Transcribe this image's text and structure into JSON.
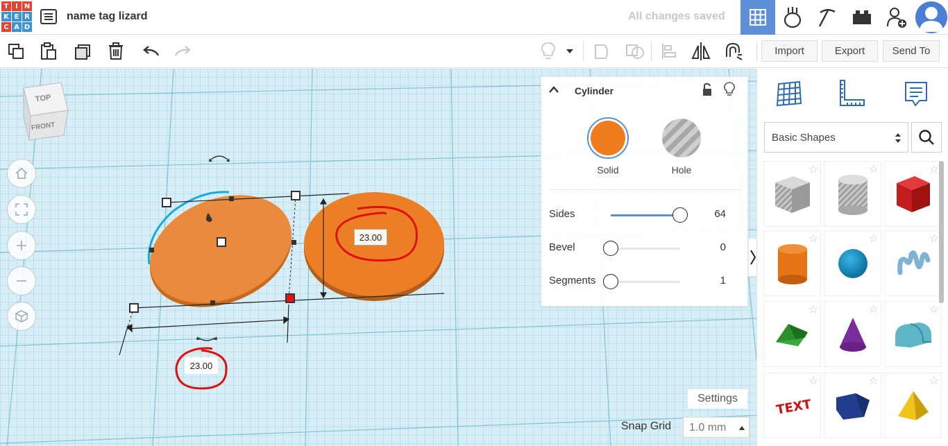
{
  "header": {
    "logo_letters": [
      "T",
      "I",
      "N",
      "K",
      "E",
      "R",
      "C",
      "A",
      "D"
    ],
    "logo_colors": [
      "#e2442f",
      "#e2442f",
      "#e2442f",
      "#3d93d1",
      "#3d93d1",
      "#3d93d1",
      "#e2442f",
      "#3d93d1",
      "#3d93d1"
    ],
    "design_title": "name tag lizard",
    "save_status": "All changes saved",
    "buttons": [
      "3d-view-icon",
      "circuits-icon",
      "blocks-icon",
      "bricks-icon",
      "add-user-icon"
    ],
    "active_color": "#5c8fd6"
  },
  "toolbar": {
    "icons": [
      "copy-icon",
      "paste-icon",
      "duplicate-icon",
      "delete-icon",
      "undo-icon",
      "redo-icon",
      "light-icon",
      "dropdown-icon",
      "group-icon",
      "ungroup-icon",
      "align-icon",
      "mirror-icon",
      "magnet-icon"
    ],
    "import_label": "Import",
    "export_label": "Export",
    "sendto_label": "Send To"
  },
  "viewcube": {
    "top_label": "TOP",
    "front_label": "FRONT"
  },
  "nav": [
    "home-icon",
    "fit-icon",
    "zoom-in-icon",
    "zoom-out-icon",
    "perspective-icon"
  ],
  "dimensions": {
    "width_value": "23.00",
    "depth_value": "23.00"
  },
  "inspector": {
    "shape_name": "Cylinder",
    "solid_label": "Solid",
    "hole_label": "Hole",
    "solid_color": "#f07c1e",
    "params": [
      {
        "label": "Sides",
        "value": "64",
        "fill": 1.0
      },
      {
        "label": "Bevel",
        "value": "0",
        "fill": 0.0
      },
      {
        "label": "Segments",
        "value": "1",
        "fill": 0.0
      }
    ]
  },
  "workplane": {
    "settings_label": "Settings",
    "snap_label": "Snap Grid",
    "snap_value": "1.0 mm"
  },
  "shapes_panel": {
    "category": "Basic Shapes",
    "shapes": [
      "box-hole",
      "cylinder-hole",
      "box",
      "cylinder",
      "sphere",
      "scribble",
      "roof",
      "cone",
      "round-roof",
      "text",
      "prism",
      "pyramid"
    ]
  },
  "colors": {
    "grid_bg": "#d6eef6",
    "object_orange": "#e98a3a",
    "annotation_red": "#e01010",
    "selection_blue": "#18a8e0"
  }
}
